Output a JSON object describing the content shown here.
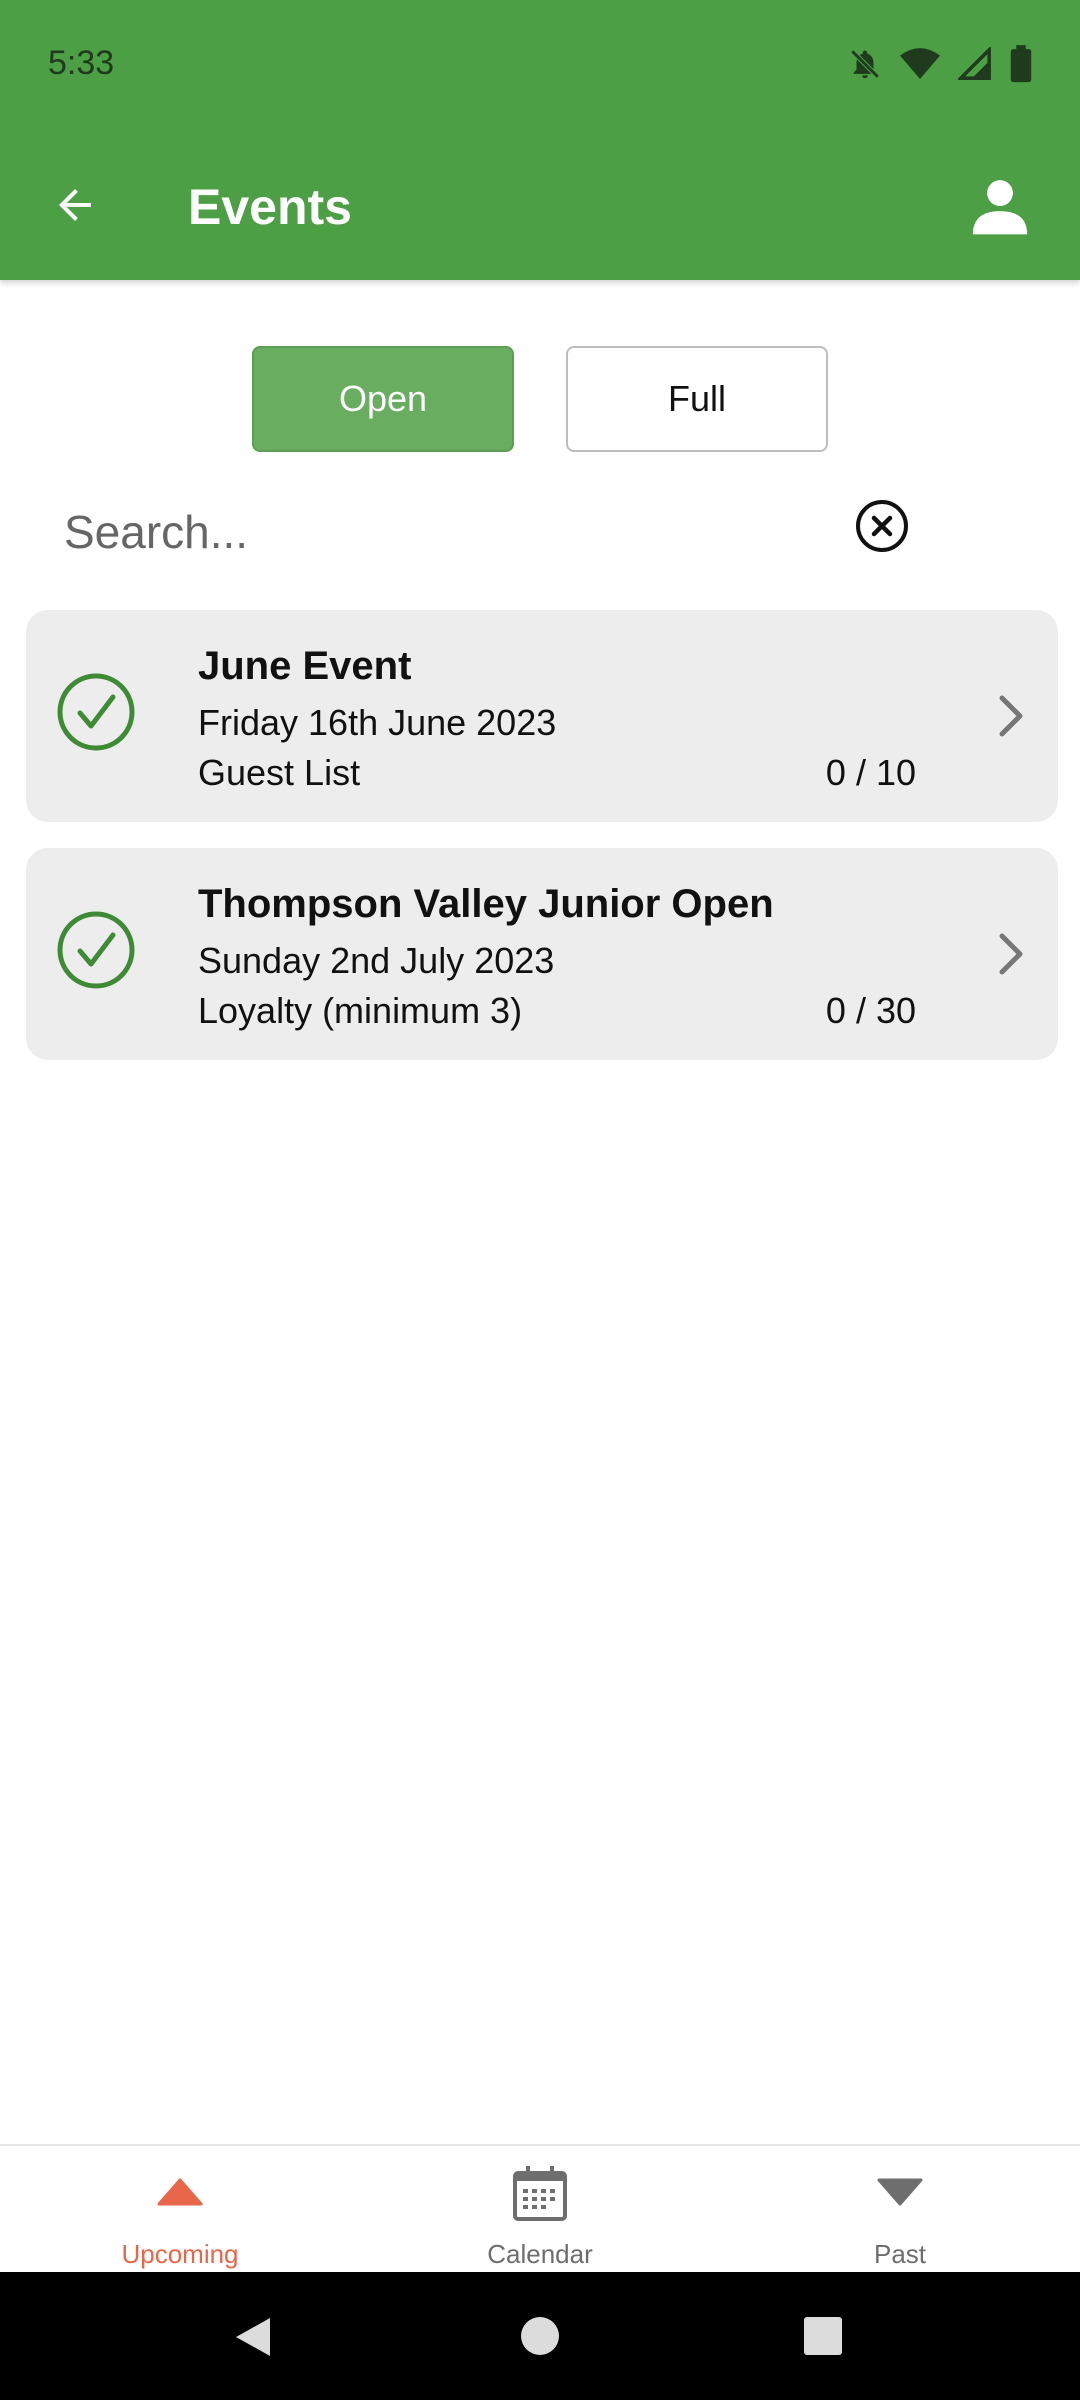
{
  "status_bar": {
    "time": "5:33",
    "icons": [
      "bell-off-icon",
      "wifi-icon",
      "signal-icon",
      "battery-icon"
    ]
  },
  "header": {
    "title": "Events",
    "back_icon": "arrow-left-icon",
    "profile_icon": "person-icon",
    "color": "#4c9f44"
  },
  "filters": {
    "open_label": "Open",
    "full_label": "Full",
    "selected": "Open"
  },
  "search": {
    "placeholder": "Search...",
    "value": ""
  },
  "events": [
    {
      "name": "June Event",
      "date": "Friday 16th June 2023",
      "list_type": "Guest List",
      "count": "0 / 10"
    },
    {
      "name": "Thompson Valley Junior Open",
      "date": "Sunday 2nd July 2023",
      "list_type": "Loyalty (minimum 3)",
      "count": "0 / 30"
    }
  ],
  "bottom_nav": {
    "items": [
      {
        "label": "Upcoming",
        "icon": "triangle-up-icon",
        "active": true
      },
      {
        "label": "Calendar",
        "icon": "calendar-icon",
        "active": false
      },
      {
        "label": "Past",
        "icon": "triangle-down-icon",
        "active": false
      }
    ],
    "active_color": "#e8664a",
    "inactive_color": "#6e6e6e"
  }
}
